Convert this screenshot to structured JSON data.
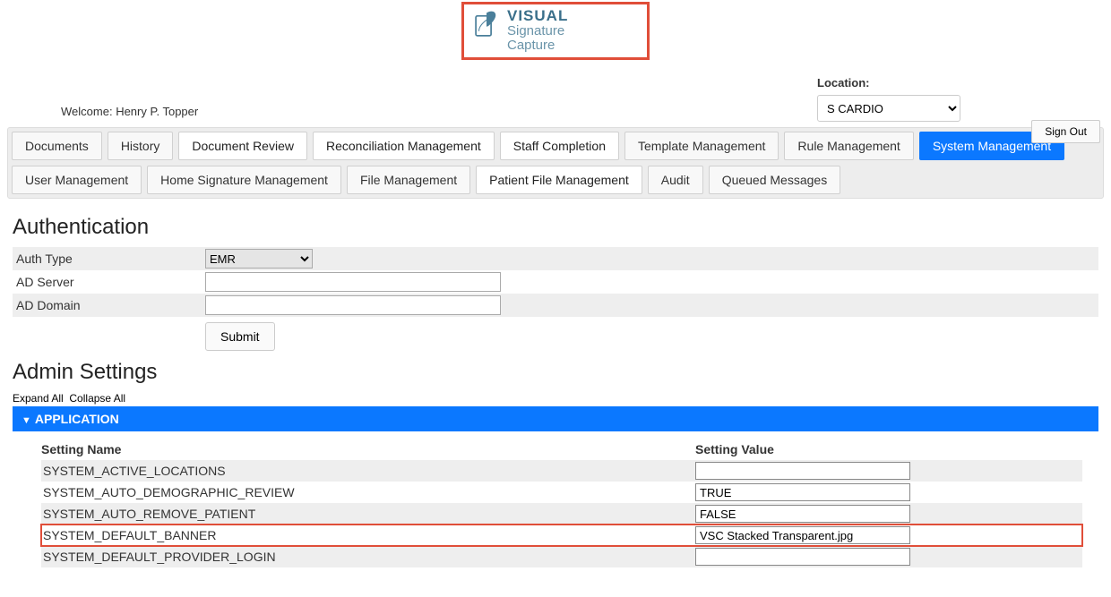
{
  "logo": {
    "l1": "VISUAL",
    "l2": "Signature",
    "l3": "Capture"
  },
  "welcome_prefix": "Welcome:",
  "welcome_user": "Henry P. Topper",
  "location_label": "Location:",
  "location_value": "S CARDIO",
  "signout_label": "Sign Out",
  "tabs_row1": [
    {
      "id": "documents",
      "label": "Documents",
      "style": "grey"
    },
    {
      "id": "history",
      "label": "History",
      "style": "grey"
    },
    {
      "id": "document-review",
      "label": "Document Review",
      "style": "white"
    },
    {
      "id": "reconciliation-management",
      "label": "Reconciliation Management",
      "style": "white"
    },
    {
      "id": "staff-completion",
      "label": "Staff Completion",
      "style": "white"
    },
    {
      "id": "template-management",
      "label": "Template Management",
      "style": "grey"
    },
    {
      "id": "rule-management",
      "label": "Rule Management",
      "style": "grey"
    },
    {
      "id": "system-management",
      "label": "System Management",
      "style": "active"
    }
  ],
  "tabs_row2": [
    {
      "id": "user-management",
      "label": "User Management",
      "style": "grey"
    },
    {
      "id": "home-signature-management",
      "label": "Home Signature Management",
      "style": "grey"
    },
    {
      "id": "file-management",
      "label": "File Management",
      "style": "grey"
    },
    {
      "id": "patient-file-management",
      "label": "Patient File Management",
      "style": "white"
    },
    {
      "id": "audit",
      "label": "Audit",
      "style": "grey"
    },
    {
      "id": "queued-messages",
      "label": "Queued Messages",
      "style": "grey"
    }
  ],
  "auth": {
    "heading": "Authentication",
    "fields": {
      "auth_type_label": "Auth Type",
      "auth_type_value": "EMR",
      "ad_server_label": "AD Server",
      "ad_server_value": "",
      "ad_domain_label": "AD Domain",
      "ad_domain_value": "",
      "submit_label": "Submit"
    }
  },
  "admin": {
    "heading": "Admin Settings",
    "expand_all": "Expand All",
    "collapse_all": "Collapse All",
    "group_title": "APPLICATION",
    "col_name": "Setting Name",
    "col_value": "Setting Value",
    "rows": [
      {
        "name": "SYSTEM_ACTIVE_LOCATIONS",
        "value": "",
        "highlight": false
      },
      {
        "name": "SYSTEM_AUTO_DEMOGRAPHIC_REVIEW",
        "value": "TRUE",
        "highlight": false
      },
      {
        "name": "SYSTEM_AUTO_REMOVE_PATIENT",
        "value": "FALSE",
        "highlight": false
      },
      {
        "name": "SYSTEM_DEFAULT_BANNER",
        "value": "VSC Stacked Transparent.jpg",
        "highlight": true
      },
      {
        "name": "SYSTEM_DEFAULT_PROVIDER_LOGIN",
        "value": "",
        "highlight": false
      }
    ]
  }
}
